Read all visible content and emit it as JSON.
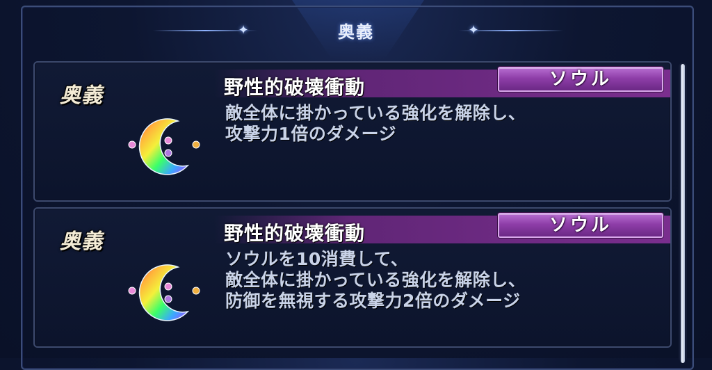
{
  "header": {
    "title": "奥義"
  },
  "skills": [
    {
      "label": "奥義",
      "name": "野性的破壊衝動",
      "badge": "ソウル",
      "description": [
        "敵全体に掛かっている強化を解除し、",
        "攻撃力1倍のダメージ"
      ],
      "icon": "rainbow-moon-icon"
    },
    {
      "label": "奥義",
      "name": "野性的破壊衝動",
      "badge": "ソウル",
      "description": [
        "ソウルを10消費して、",
        "敵全体に掛かっている強化を解除し、",
        "防御を無視する攻撃力2倍のダメージ"
      ],
      "icon": "rainbow-moon-icon"
    }
  ],
  "colors": {
    "background": "#0d1631",
    "badge": "#8e3ea8",
    "title_bar": "#7a2e8e",
    "text": "#c9d3e8"
  }
}
